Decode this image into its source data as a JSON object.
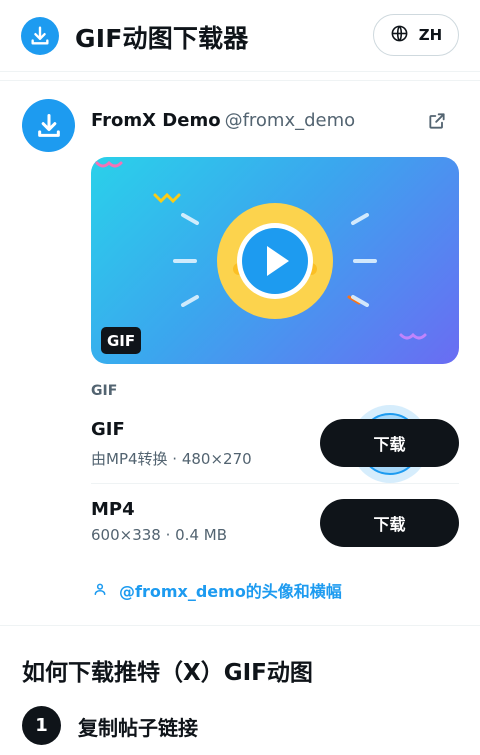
{
  "header": {
    "app_title": "GIF动图下载器",
    "lang_label": "ZH",
    "logo_icon": "download-icon",
    "lang_icon": "globe-icon"
  },
  "tweet": {
    "display_name": "FromX Demo",
    "handle": "@fromx_demo",
    "media_badge": "GIF",
    "section_label": "GIF",
    "formats": [
      {
        "title": "GIF",
        "meta": "由MP4转换 · 480×270",
        "button": "下载"
      },
      {
        "title": "MP4",
        "meta": "600×338 · 0.4 MB",
        "button": "下载"
      }
    ],
    "profile_link": "@fromx_demo的头像和横幅"
  },
  "howto": {
    "title": "如何下载推特（X）GIF动图",
    "steps": [
      {
        "num": "1",
        "text": "复制帖子链接"
      }
    ]
  },
  "colors": {
    "accent": "#1d9bf0",
    "dark": "#0f1419",
    "muted": "#536471"
  }
}
